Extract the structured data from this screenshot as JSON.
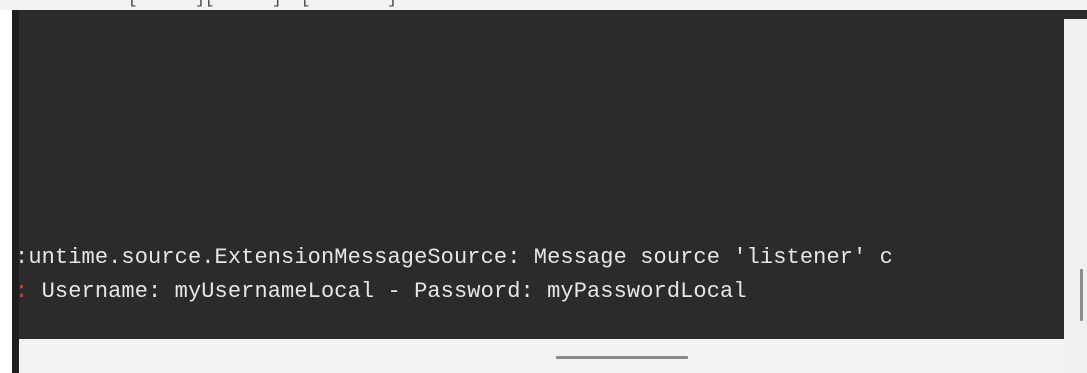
{
  "top_strip": {
    "text": "[      ][      ]  [        ]"
  },
  "console": {
    "lines": [
      {
        "prefix": ":",
        "text": "untime.source.ExtensionMessageSource: Message source 'listener' c"
      },
      {
        "prefix": ":",
        "text": " Username: myUsernameLocal - Password: myPasswordLocal"
      }
    ]
  },
  "colors": {
    "console_background": "#2b2b2b",
    "console_text": "#e6e6e6",
    "gutter_mark": "#cc4444",
    "scrollbar_track": "#f0f0f0",
    "scrollbar_thumb": "#8a8a8a"
  }
}
